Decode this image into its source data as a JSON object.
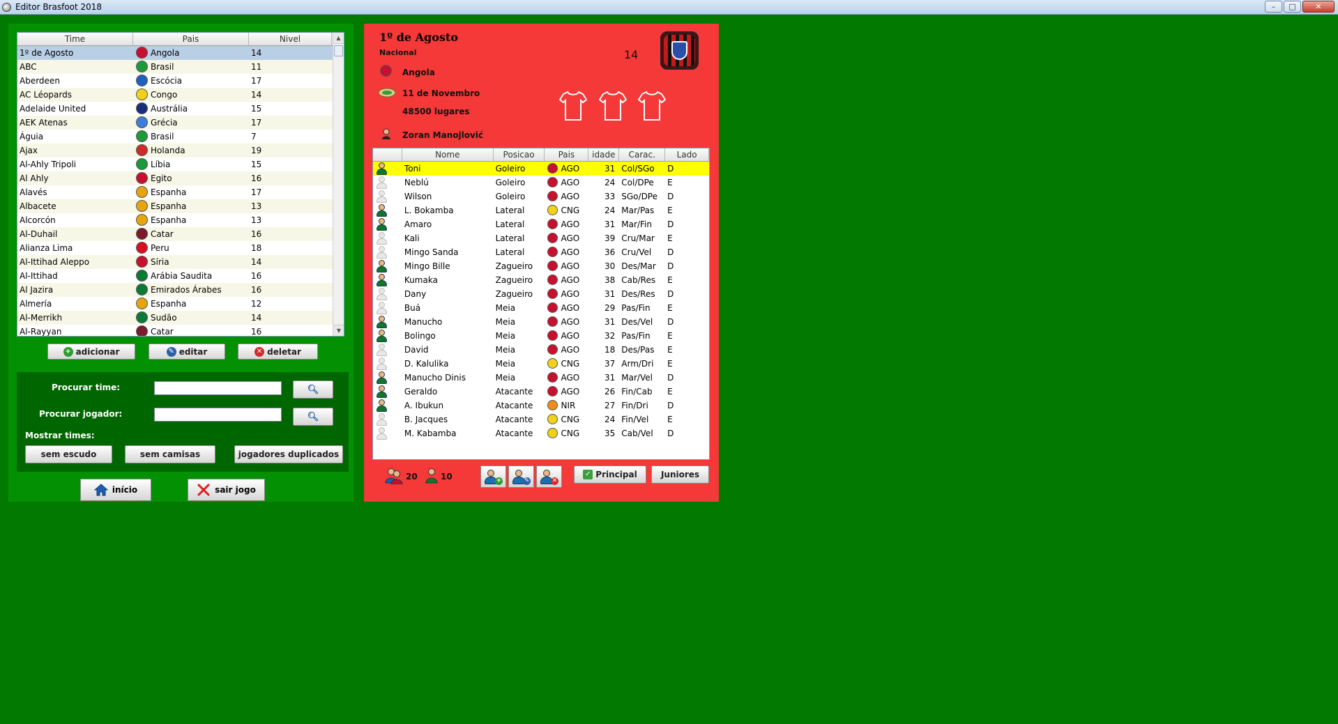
{
  "window": {
    "title": "Editor Brasfoot 2018",
    "min_glyph": "–",
    "max_glyph": "□",
    "close_glyph": "✕"
  },
  "colors": {
    "background": "#027a02",
    "left_panel": "#039003",
    "search_panel": "#006600",
    "right_panel": "#f53838",
    "selected_player_row": "#ffff00",
    "selected_team_row": "#b8cfe5"
  },
  "teams_table": {
    "columns": [
      "Time",
      "Pais",
      "Nivel"
    ],
    "rows": [
      {
        "time": "1º de Agosto",
        "pais": "Angola",
        "nivel": "14",
        "flag": "#c8102e"
      },
      {
        "time": "ABC",
        "pais": "Brasil",
        "nivel": "11",
        "flag": "#1d9b3a"
      },
      {
        "time": "Aberdeen",
        "pais": "Escócia",
        "nivel": "17",
        "flag": "#1f5fbf"
      },
      {
        "time": "AC Léopards",
        "pais": "Congo",
        "nivel": "14",
        "flag": "#f2d11b"
      },
      {
        "time": "Adelaide United",
        "pais": "Austrália",
        "nivel": "15",
        "flag": "#1a2f7a"
      },
      {
        "time": "AEK Atenas",
        "pais": "Grécia",
        "nivel": "17",
        "flag": "#3b7dd8"
      },
      {
        "time": "Águia",
        "pais": "Brasil",
        "nivel": "7",
        "flag": "#1d9b3a"
      },
      {
        "time": "Ajax",
        "pais": "Holanda",
        "nivel": "19",
        "flag": "#d02a2a"
      },
      {
        "time": "Al-Ahly Tripoli",
        "pais": "Líbia",
        "nivel": "15",
        "flag": "#1a9a3a"
      },
      {
        "time": "Al Ahly",
        "pais": "Egito",
        "nivel": "16",
        "flag": "#c8102e"
      },
      {
        "time": "Alavés",
        "pais": "Espanha",
        "nivel": "17",
        "flag": "#e8a40f"
      },
      {
        "time": "Albacete",
        "pais": "Espanha",
        "nivel": "13",
        "flag": "#e8a40f"
      },
      {
        "time": "Alcorcón",
        "pais": "Espanha",
        "nivel": "13",
        "flag": "#e8a40f"
      },
      {
        "time": "Al-Duhail",
        "pais": "Catar",
        "nivel": "16",
        "flag": "#7a1a2a"
      },
      {
        "time": "Alianza Lima",
        "pais": "Peru",
        "nivel": "18",
        "flag": "#d91023"
      },
      {
        "time": "Al-Ittihad Aleppo",
        "pais": "Síria",
        "nivel": "14",
        "flag": "#c8102e"
      },
      {
        "time": "Al-Ittihad",
        "pais": "Arábia Saudita",
        "nivel": "16",
        "flag": "#0b7a35"
      },
      {
        "time": "Al Jazira",
        "pais": "Emirados Árabes",
        "nivel": "16",
        "flag": "#0b7a35"
      },
      {
        "time": "Almería",
        "pais": "Espanha",
        "nivel": "12",
        "flag": "#e8a40f"
      },
      {
        "time": "Al-Merrikh",
        "pais": "Sudão",
        "nivel": "14",
        "flag": "#0b7a35"
      },
      {
        "time": "Al-Rayyan",
        "pais": "Catar",
        "nivel": "16",
        "flag": "#7a1a2a"
      }
    ]
  },
  "team_actions": {
    "add": "adicionar",
    "edit": "editar",
    "delete": "deletar"
  },
  "search": {
    "team_label": "Procurar time:",
    "player_label": "Procurar jogador:",
    "team_value": "",
    "player_value": "",
    "show_label": "Mostrar times:",
    "no_crest": "sem escudo",
    "no_shirts": "sem camisas",
    "duplicates": "jogadores duplicados"
  },
  "bottom_actions": {
    "home": "início",
    "quit": "sair jogo"
  },
  "club": {
    "name": "1º de Agosto",
    "category": "Nacional",
    "level": "14",
    "country": "Angola",
    "stadium": "11 de Novembro",
    "capacity": "48500 lugares",
    "coach": "Zoran Manojlović"
  },
  "players_table": {
    "columns": [
      "Nome",
      "Posicao",
      "Pais",
      "idade",
      "Carac.",
      "Lado"
    ],
    "rows": [
      {
        "nome": "Toni",
        "posicao": "Goleiro",
        "pais": "AGO",
        "idade": "31",
        "carac": "Col/SGo",
        "lado": "D",
        "starter": true,
        "flag": "#c8102e"
      },
      {
        "nome": "Neblú",
        "posicao": "Goleiro",
        "pais": "AGO",
        "idade": "24",
        "carac": "Col/DPe",
        "lado": "E",
        "starter": false,
        "flag": "#c8102e"
      },
      {
        "nome": "Wilson",
        "posicao": "Goleiro",
        "pais": "AGO",
        "idade": "33",
        "carac": "SGo/DPe",
        "lado": "D",
        "starter": false,
        "flag": "#c8102e"
      },
      {
        "nome": "L. Bokamba",
        "posicao": "Lateral",
        "pais": "CNG",
        "idade": "24",
        "carac": "Mar/Pas",
        "lado": "E",
        "starter": true,
        "flag": "#f2d11b"
      },
      {
        "nome": "Amaro",
        "posicao": "Lateral",
        "pais": "AGO",
        "idade": "31",
        "carac": "Mar/Fin",
        "lado": "D",
        "starter": true,
        "flag": "#c8102e"
      },
      {
        "nome": "Kali",
        "posicao": "Lateral",
        "pais": "AGO",
        "idade": "39",
        "carac": "Cru/Mar",
        "lado": "E",
        "starter": false,
        "flag": "#c8102e"
      },
      {
        "nome": "Mingo Sanda",
        "posicao": "Lateral",
        "pais": "AGO",
        "idade": "36",
        "carac": "Cru/Vel",
        "lado": "D",
        "starter": false,
        "flag": "#c8102e"
      },
      {
        "nome": "Mingo Bille",
        "posicao": "Zagueiro",
        "pais": "AGO",
        "idade": "30",
        "carac": "Des/Mar",
        "lado": "D",
        "starter": true,
        "flag": "#c8102e"
      },
      {
        "nome": "Kumaka",
        "posicao": "Zagueiro",
        "pais": "AGO",
        "idade": "38",
        "carac": "Cab/Res",
        "lado": "E",
        "starter": true,
        "flag": "#c8102e"
      },
      {
        "nome": "Dany",
        "posicao": "Zagueiro",
        "pais": "AGO",
        "idade": "31",
        "carac": "Des/Res",
        "lado": "D",
        "starter": false,
        "flag": "#c8102e"
      },
      {
        "nome": "Buá",
        "posicao": "Meia",
        "pais": "AGO",
        "idade": "29",
        "carac": "Pas/Fin",
        "lado": "E",
        "starter": false,
        "flag": "#c8102e"
      },
      {
        "nome": "Manucho",
        "posicao": "Meia",
        "pais": "AGO",
        "idade": "31",
        "carac": "Des/Vel",
        "lado": "D",
        "starter": true,
        "flag": "#c8102e"
      },
      {
        "nome": "Bolingo",
        "posicao": "Meia",
        "pais": "AGO",
        "idade": "32",
        "carac": "Pas/Fin",
        "lado": "E",
        "starter": true,
        "flag": "#c8102e"
      },
      {
        "nome": "David",
        "posicao": "Meia",
        "pais": "AGO",
        "idade": "18",
        "carac": "Des/Pas",
        "lado": "E",
        "starter": false,
        "flag": "#c8102e"
      },
      {
        "nome": "D. Kalulika",
        "posicao": "Meia",
        "pais": "CNG",
        "idade": "37",
        "carac": "Arm/Dri",
        "lado": "E",
        "starter": false,
        "flag": "#f2d11b"
      },
      {
        "nome": "Manucho Dinis",
        "posicao": "Meia",
        "pais": "AGO",
        "idade": "31",
        "carac": "Mar/Vel",
        "lado": "D",
        "starter": true,
        "flag": "#c8102e"
      },
      {
        "nome": "Geraldo",
        "posicao": "Atacante",
        "pais": "AGO",
        "idade": "26",
        "carac": "Fin/Cab",
        "lado": "E",
        "starter": true,
        "flag": "#c8102e"
      },
      {
        "nome": "A. Ibukun",
        "posicao": "Atacante",
        "pais": "NIR",
        "idade": "27",
        "carac": "Fin/Dri",
        "lado": "D",
        "starter": true,
        "flag": "#f08c1c"
      },
      {
        "nome": "B. Jacques",
        "posicao": "Atacante",
        "pais": "CNG",
        "idade": "24",
        "carac": "Fin/Vel",
        "lado": "E",
        "starter": false,
        "flag": "#f2d11b"
      },
      {
        "nome": "M. Kabamba",
        "posicao": "Atacante",
        "pais": "CNG",
        "idade": "35",
        "carac": "Cab/Vel",
        "lado": "D",
        "starter": false,
        "flag": "#f2d11b"
      }
    ]
  },
  "squad_stats": {
    "total_players": "20",
    "starters": "10"
  },
  "roster_tabs": {
    "main": "Principal",
    "juniors": "Juniores"
  }
}
